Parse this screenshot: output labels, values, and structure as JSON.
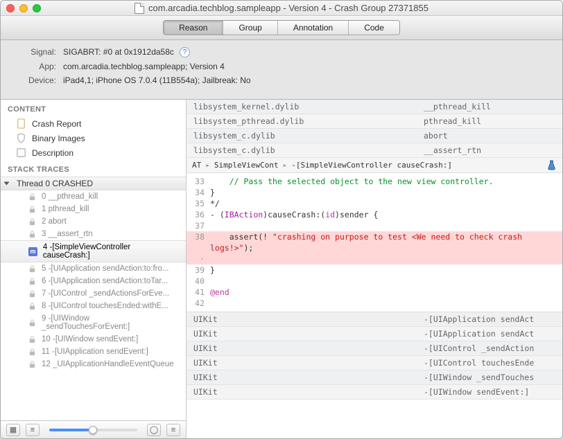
{
  "window": {
    "title": "com.arcadia.techblog.sampleapp - Version 4 - Crash Group 27371855"
  },
  "tabs": {
    "reason": "Reason",
    "group": "Group",
    "annotation": "Annotation",
    "code": "Code"
  },
  "meta": {
    "signal_k": "Signal:",
    "signal_v": "SIGABRT: #0 at 0x1912da58c",
    "app_k": "App:",
    "app_v": "com.arcadia.techblog.sampleapp; Version 4",
    "device_k": "Device:",
    "device_v": "iPad4,1; iPhone OS 7.0.4 (11B554a); Jailbreak: No"
  },
  "sidebar": {
    "content_h": "CONTENT",
    "items": [
      {
        "label": "Crash Report"
      },
      {
        "label": "Binary Images"
      },
      {
        "label": "Description"
      }
    ],
    "traces_h": "STACK TRACES",
    "thread": "Thread 0 CRASHED",
    "frames": [
      {
        "label": "0 __pthread_kill"
      },
      {
        "label": "1 pthread_kill"
      },
      {
        "label": "2 abort"
      },
      {
        "label": "3 __assert_rtn"
      },
      {
        "label": "4 -[SimpleViewController causeCrash:]"
      },
      {
        "label": "5 -[UIApplication sendAction:to:fro..."
      },
      {
        "label": "6 -[UIApplication sendAction:toTar..."
      },
      {
        "label": "7 -[UIControl _sendActionsForEve..."
      },
      {
        "label": "8 -[UIControl touchesEnded:withE..."
      },
      {
        "label": "9 -[UIWindow _sendTouchesForEvent:]"
      },
      {
        "label": "10 -[UIWindow sendEvent:]"
      },
      {
        "label": "11 -[UIApplication sendEvent:]"
      },
      {
        "label": "12 _UIApplicationHandleEventQueue"
      }
    ]
  },
  "toplist": [
    {
      "lib": "libsystem_kernel.dylib",
      "sym": "__pthread_kill"
    },
    {
      "lib": "libsystem_pthread.dylib",
      "sym": "pthread_kill"
    },
    {
      "lib": "libsystem_c.dylib",
      "sym": "abort"
    },
    {
      "lib": "libsystem_c.dylib",
      "sym": "__assert_rtn"
    }
  ],
  "crumb": {
    "a": "AT",
    "b": "SimpleViewCont",
    "c": "-[SimpleViewController causeCrash:]"
  },
  "code": {
    "l33": "    // Pass the selected object to the new view controller.",
    "l34": "}",
    "l35": "*/",
    "l36a": "- (",
    "l36b": "IBAction",
    "l36c": ")causeCrash:(",
    "l36d": "id",
    "l36e": ")sender {",
    "l37": "",
    "l38a": "    assert(! ",
    "l38b": "\"crashing on purpose to test <We need to check crash logs!>\"",
    "l38c": ");",
    "l39": "}",
    "l40": "",
    "l41": "@end",
    "l42": ""
  },
  "botlist": [
    {
      "lib": "UIKit",
      "sym": "-[UIApplication sendAct"
    },
    {
      "lib": "UIKit",
      "sym": "-[UIApplication sendAct"
    },
    {
      "lib": "UIKit",
      "sym": "-[UIControl _sendAction"
    },
    {
      "lib": "UIKit",
      "sym": "-[UIControl touchesEnde"
    },
    {
      "lib": "UIKit",
      "sym": "-[UIWindow _sendTouches"
    },
    {
      "lib": "UIKit",
      "sym": "-[UIWindow sendEvent:]"
    }
  ],
  "gutters": {
    "g33": "33",
    "g34": "34",
    "g35": "35",
    "g36": "36",
    "g37": "37",
    "g38": "38",
    "gdot": "·",
    "g39": "39",
    "g40": "40",
    "g41": "41",
    "g42": "42"
  }
}
